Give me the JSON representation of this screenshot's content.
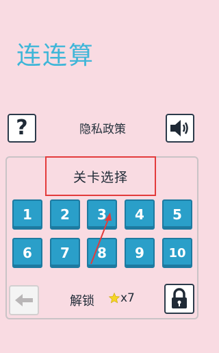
{
  "app": {
    "title": "连连算"
  },
  "header": {
    "help_label": "?",
    "privacy_label": "隐私政策"
  },
  "panel": {
    "title": "关卡选择",
    "levels": [
      "1",
      "2",
      "3",
      "4",
      "5",
      "6",
      "7",
      "8",
      "9",
      "10"
    ]
  },
  "footer": {
    "unlock_label": "解锁",
    "star_count": "x7"
  },
  "colors": {
    "background": "#f9dbe2",
    "title": "#3fb6d8",
    "tile": "#2a9fc9",
    "highlight_box": "#e33b3b",
    "annotation_arrow": "#e33b3b",
    "star": "#f5d426"
  },
  "icons": [
    "help-icon",
    "speaker-icon",
    "back-arrow-icon",
    "star-icon",
    "lock-icon"
  ]
}
